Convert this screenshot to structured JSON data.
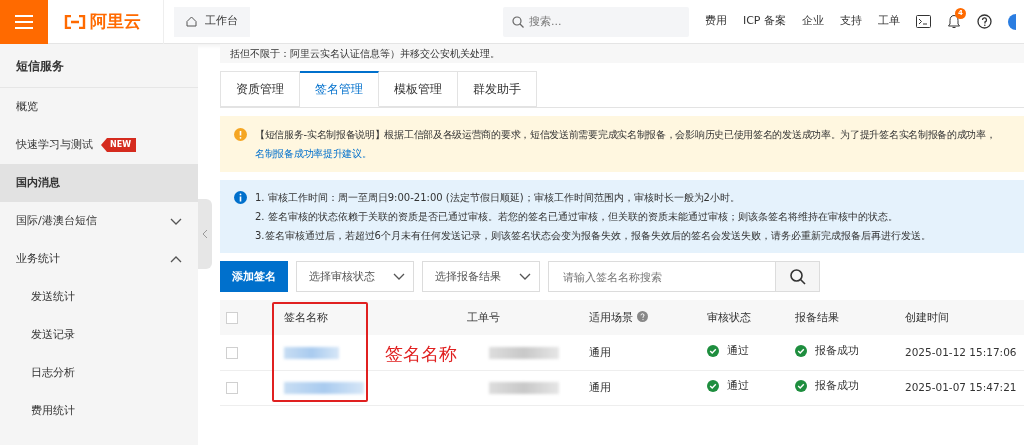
{
  "header": {
    "logo": "阿里云",
    "workbench": "工作台",
    "search": {
      "placeholder": "搜索..."
    },
    "links": [
      "费用",
      "ICP 备案",
      "企业",
      "支持",
      "工单"
    ],
    "notification_count": "4"
  },
  "sidebar": {
    "title": "短信服务",
    "items": [
      {
        "label": "概览",
        "selected": false
      },
      {
        "label": "快速学习与测试",
        "badge": "NEW",
        "selected": false
      },
      {
        "label": "国内消息",
        "selected": true
      },
      {
        "label": "国际/港澳台短信",
        "expanded": false,
        "selected": false
      },
      {
        "label": "业务统计",
        "expanded": true,
        "selected": false,
        "children": [
          {
            "label": "发送统计",
            "selected": false
          },
          {
            "label": "发送记录",
            "selected": false
          },
          {
            "label": "日志分析",
            "selected": false
          },
          {
            "label": "费用统计",
            "selected": false
          }
        ]
      }
    ]
  },
  "notice_fragment": "括但不限于：阿里云实名认证信息等）并移交公安机关处理。",
  "tabs": [
    {
      "label": "资质管理",
      "selected": false
    },
    {
      "label": "签名管理",
      "selected": true
    },
    {
      "label": "模板管理",
      "selected": false
    },
    {
      "label": "群发助手",
      "selected": false
    }
  ],
  "warning": {
    "text": "【短信服务-实名制报备说明】根据工信部及各级运营商的要求，短信发送前需要完成实名制报备，会影响历史已使用签名的发送成功率。为了提升签名实名制报备的成功率，",
    "link": "名制报备成功率提升建议。"
  },
  "info": [
    "1. 审核工作时间：周一至周日9:00-21:00 (法定节假日顺延)；审核工作时间范围内，审核时长一般为2小时。",
    "2. 签名审核的状态依赖于关联的资质是否已通过审核。若您的签名已通过审核，但关联的资质未能通过审核；则该条签名将维持在审核中的状态。",
    "3.签名审核通过后，若超过6个月未有任何发送记录，则该签名状态会变为报备失效，报备失效后的签名会发送失败，请务必重新完成报备后再进行发送。"
  ],
  "toolbar": {
    "add_button": "添加签名",
    "filters": [
      "选择审核状态",
      "选择报备结果"
    ],
    "search": {
      "placeholder": "请输入签名名称搜索"
    }
  },
  "table": {
    "select_all_checked": false,
    "columns": [
      "签名名称",
      "工单号",
      "适用场景",
      "审核状态",
      "报备结果",
      "创建时间"
    ],
    "rows": [
      {
        "checked": false,
        "scene": "通用",
        "review": "通过",
        "filing": "报备成功",
        "created": "2025-01-12 15:17:06"
      },
      {
        "checked": false,
        "scene": "通用",
        "review": "通过",
        "filing": "报备成功",
        "created": "2025-01-07 15:47:21"
      }
    ]
  },
  "annotation": {
    "label": "签名名称"
  }
}
